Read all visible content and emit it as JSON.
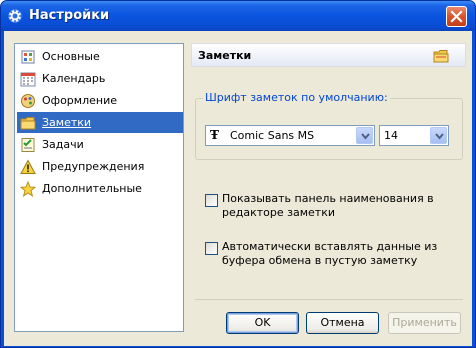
{
  "window": {
    "title": "Настройки"
  },
  "sidebar": {
    "items": [
      {
        "label": "Основные",
        "icon": "settings-page-icon"
      },
      {
        "label": "Календарь",
        "icon": "calendar-icon"
      },
      {
        "label": "Оформление",
        "icon": "appearance-icon"
      },
      {
        "label": "Заметки",
        "icon": "notes-folder-icon",
        "selected": true
      },
      {
        "label": "Задачи",
        "icon": "tasks-checklist-icon"
      },
      {
        "label": "Предупреждения",
        "icon": "warning-icon"
      },
      {
        "label": "Дополнительные",
        "icon": "star-icon"
      }
    ]
  },
  "panel": {
    "title": "Заметки",
    "font_group_label": "Шрифт заметок по умолчанию:",
    "font_name": "Comic Sans MS",
    "font_size": "14",
    "options": [
      {
        "label": "Показывать панель наименования в редакторе заметки",
        "checked": false
      },
      {
        "label": "Автоматически вставлять данные из буфера обмена в пустую заметку",
        "checked": false
      }
    ]
  },
  "buttons": {
    "ok": "OK",
    "cancel": "Отмена",
    "apply": "Применить"
  },
  "colors": {
    "selection": "#316ac5",
    "group_label": "#0046d5",
    "titlebar": "#0a55e0"
  }
}
